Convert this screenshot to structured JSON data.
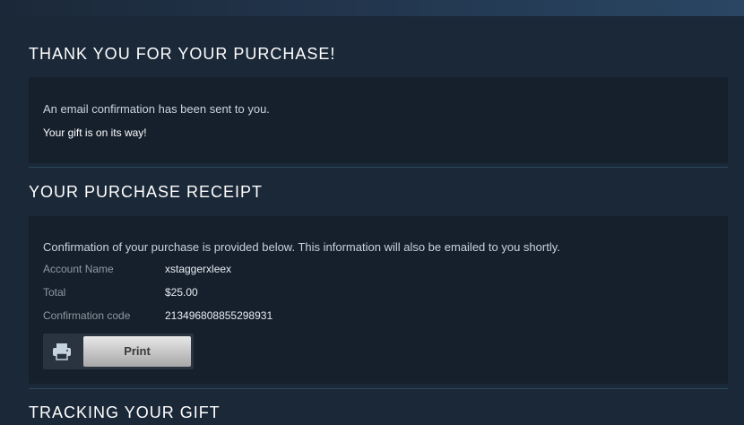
{
  "thank_you": {
    "title": "THANK YOU FOR YOUR PURCHASE!",
    "email_message": "An email confirmation has been sent to you.",
    "gift_message": "Your gift is on its way!"
  },
  "receipt": {
    "title": "YOUR PURCHASE RECEIPT",
    "intro": "Confirmation of your purchase is provided below. This information will also be emailed to you shortly.",
    "rows": [
      {
        "label": "Account Name",
        "value": "xstaggerxleex"
      },
      {
        "label": "Total",
        "value": "$25.00"
      },
      {
        "label": "Confirmation code",
        "value": "213496808855298931"
      }
    ],
    "print_label": "Print",
    "print_icon": "printer-icon"
  },
  "tracking": {
    "title": "TRACKING YOUR GIFT"
  },
  "colors": {
    "page_bg": "#1b2838",
    "panel_bg": "#16202d",
    "heading": "#ffffff",
    "label": "#8f98a0"
  }
}
